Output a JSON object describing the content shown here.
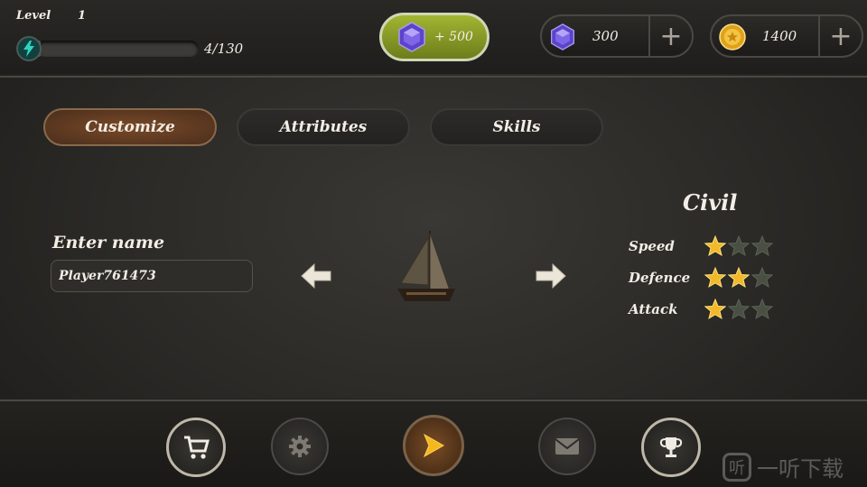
{
  "header": {
    "level_label": "Level",
    "level_value": "1",
    "energy_count": "4/130",
    "energy_progress": 0.03,
    "gem_bonus": "+ 500",
    "gems": "300",
    "coins": "1400",
    "plus": "+"
  },
  "tabs": [
    {
      "label": "Customize",
      "active": true
    },
    {
      "label": "Attributes",
      "active": false
    },
    {
      "label": "Skills",
      "active": false
    }
  ],
  "name": {
    "label": "Enter name",
    "value": "Player761473"
  },
  "ship": {
    "class_name": "Civil",
    "stats": [
      {
        "label": "Speed",
        "stars": 1,
        "max": 3
      },
      {
        "label": "Defence",
        "stars": 2,
        "max": 3
      },
      {
        "label": "Attack",
        "stars": 1,
        "max": 3
      }
    ]
  },
  "nav": [
    "cart-icon",
    "gear-icon",
    "play-icon",
    "mail-icon",
    "trophy-icon"
  ],
  "watermark": {
    "glyph": "听",
    "text": "一听下载"
  },
  "colors": {
    "accent_gold": "#f0b82a",
    "star_empty": "#4a4f44",
    "gem_purple": "#6a4fd6"
  }
}
